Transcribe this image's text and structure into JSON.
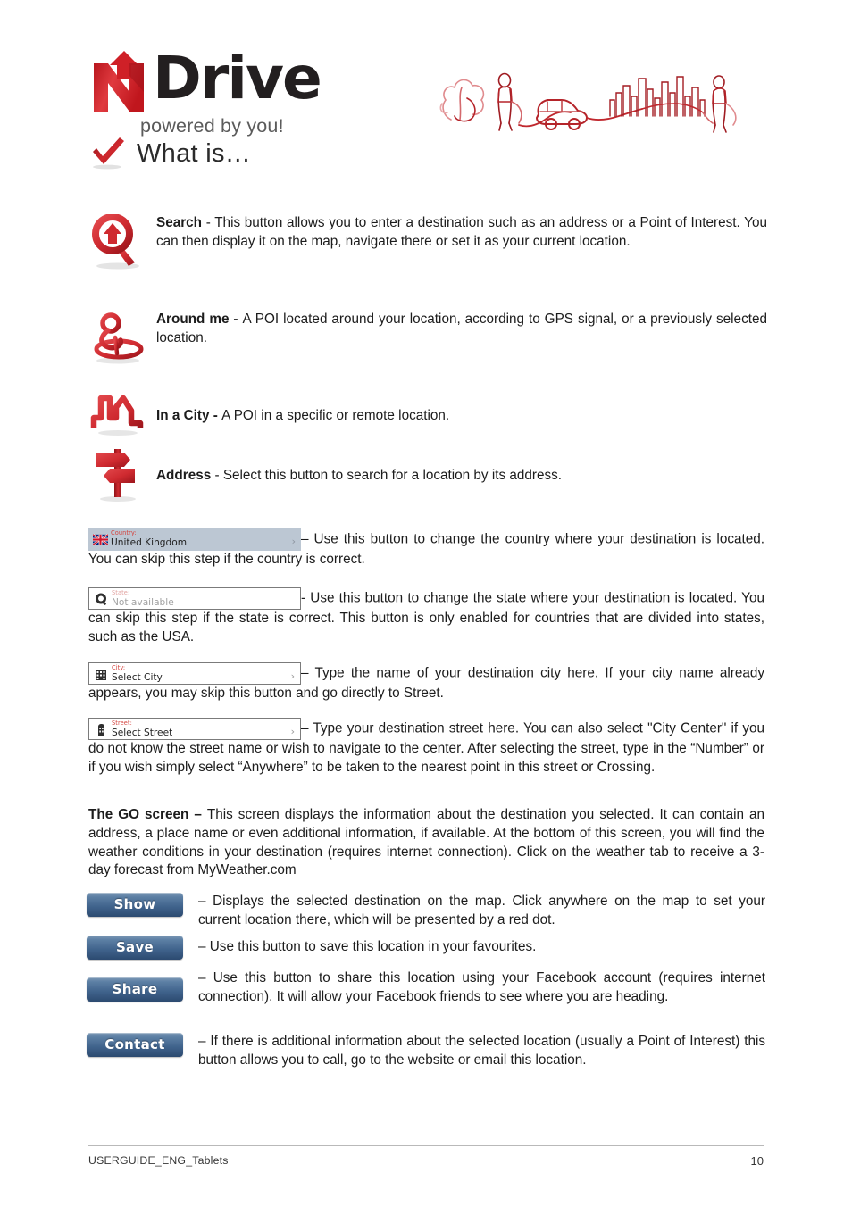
{
  "brand": {
    "logo_letter": "N",
    "logo_word": "Drive",
    "tagline": "powered by you!",
    "accent_color": "#cf2027",
    "dark_color": "#231f20"
  },
  "header": {
    "section_title": "What is…",
    "check_icon": "check-mark-icon",
    "illustration": "city-scene-line-art"
  },
  "features": [
    {
      "icon": "search-magnifier-icon",
      "term": "Search",
      "body": " - This button allows you to enter a destination such as an address or a Point of Interest. You can then display it on the map, navigate there or set it as your current location."
    },
    {
      "icon": "around-me-person-icon",
      "term": "Around me - ",
      "body": "A POI located around your location, according to GPS signal, or a previously selected location."
    },
    {
      "icon": "in-a-city-skyline-icon",
      "term": "In a City - ",
      "body": "A POI in a specific or remote location."
    },
    {
      "icon": "address-signpost-icon",
      "term": "Address",
      "body": " - Select this button to search for a location by its address."
    }
  ],
  "fields": [
    {
      "name": "country",
      "icon": "uk-flag-icon",
      "label": "Country:",
      "value": "United Kingdom",
      "chevron": "›",
      "style": "filled",
      "disabled": false,
      "description": "– Use this button to change the country where your destination is located. You can skip this step if the country is correct."
    },
    {
      "name": "state",
      "icon": "state-magnifier-icon",
      "label": "State:",
      "value": "Not available",
      "chevron": "",
      "style": "boxed",
      "disabled": true,
      "description": "- Use this button to change the state where your destination is located. You can skip this step if the state is correct. This button is only enabled for countries that are divided into states, such as the USA."
    },
    {
      "name": "city",
      "icon": "city-building-icon",
      "label": "City:",
      "value": "Select City",
      "chevron": "›",
      "style": "boxed",
      "disabled": false,
      "description": "– Type the name of your destination city here. If your city name already appears, you may skip this button and go directly to Street."
    },
    {
      "name": "street",
      "icon": "street-tower-icon",
      "label": "Street:",
      "value": "Select Street",
      "chevron": "›",
      "style": "boxed",
      "disabled": false,
      "description": "– Type your destination street here. You can also select \"City Center\" if you do not know the street name or wish to navigate to the center. After selecting the street, type in the “Number” or if you wish simply select “Anywhere” to be taken to the nearest point in this street or Crossing."
    }
  ],
  "go_screen": {
    "term": "The GO screen – ",
    "body": "This screen displays the information about the destination you selected. It can contain an address, a place name or even additional information, if available. At the bottom of this screen, you will find the weather conditions in your destination (requires internet connection). Click on the weather tab to receive a 3-day forecast from MyWeather.com"
  },
  "buttons": [
    {
      "label": "Show",
      "description": "– Displays the selected destination on the map. Click anywhere on the map to set your current location there, which will be presented by a red dot."
    },
    {
      "label": "Save",
      "description": "– Use this button to save this location in your favourites."
    },
    {
      "label": "Share",
      "description": "– Use this button to share this location using your Facebook account (requires internet connection). It will allow your Facebook friends to see where you are heading."
    },
    {
      "label": "Contact",
      "description": "– If there is additional information about the selected location (usually a Point of Interest) this button allows you to call, go to the website or email this location."
    }
  ],
  "footer": {
    "document_name": "USERGUIDE_ENG_Tablets",
    "page_number": "10"
  }
}
